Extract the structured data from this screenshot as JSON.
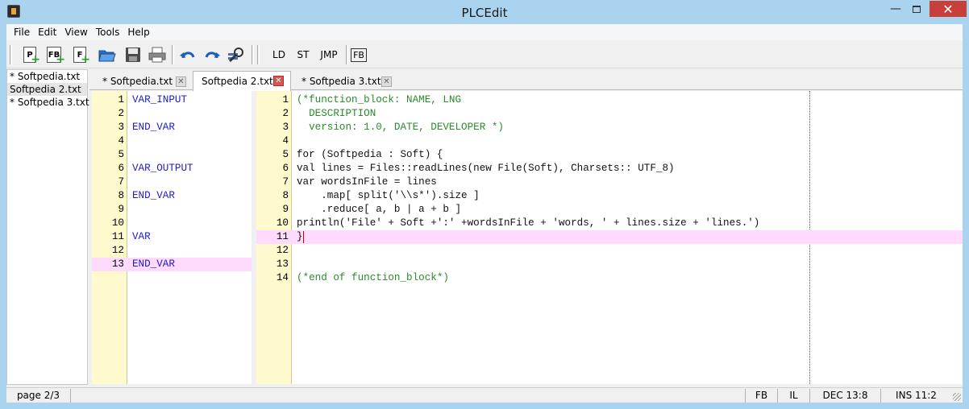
{
  "window": {
    "title": "PLCEdit"
  },
  "menu": [
    "File",
    "Edit",
    "View",
    "Tools",
    "Help"
  ],
  "toolbar": {
    "new_buttons": [
      "P",
      "FB",
      "F"
    ],
    "lang_buttons": [
      "LD",
      "ST",
      "JMP"
    ],
    "fb_button": "FB"
  },
  "files": [
    "* Softpedia.txt",
    "Softpedia 2.txt",
    "* Softpedia 3.txt"
  ],
  "tabs": [
    {
      "label": "* Softpedia.txt",
      "active": false
    },
    {
      "label": "Softpedia 2.txt",
      "active": true
    },
    {
      "label": "* Softpedia 3.txt",
      "active": false
    }
  ],
  "left_editor": {
    "current_line": 13,
    "lines": [
      {
        "n": "1",
        "text": "VAR_INPUT"
      },
      {
        "n": "2",
        "text": ""
      },
      {
        "n": "3",
        "text": "END_VAR"
      },
      {
        "n": "4",
        "text": ""
      },
      {
        "n": "5",
        "text": ""
      },
      {
        "n": "6",
        "text": "VAR_OUTPUT"
      },
      {
        "n": "7",
        "text": ""
      },
      {
        "n": "8",
        "text": "END_VAR"
      },
      {
        "n": "9",
        "text": ""
      },
      {
        "n": "10",
        "text": ""
      },
      {
        "n": "11",
        "text": "VAR"
      },
      {
        "n": "12",
        "text": ""
      },
      {
        "n": "13",
        "text": "END_VAR"
      }
    ]
  },
  "right_editor": {
    "current_line": 11,
    "lines": [
      {
        "n": "1",
        "text": "(*function_block: NAME, LNG",
        "style": "comment"
      },
      {
        "n": "2",
        "text": "  DESCRIPTION",
        "style": "comment"
      },
      {
        "n": "3",
        "text": "  version: 1.0, DATE, DEVELOPER *)",
        "style": "comment"
      },
      {
        "n": "4",
        "text": "",
        "style": "plain"
      },
      {
        "n": "5",
        "text": "for (Softpedia : Soft) {",
        "style": "plain"
      },
      {
        "n": "6",
        "text": "val lines = Files::readLines(new File(Soft), Charsets:: UTF_8)",
        "style": "plain"
      },
      {
        "n": "7",
        "text": "var wordsInFile = lines",
        "style": "plain"
      },
      {
        "n": "8",
        "text": "    .map[ split('\\\\s*').size ]",
        "style": "plain"
      },
      {
        "n": "9",
        "text": "    .reduce[ a, b | a + b ]",
        "style": "plain"
      },
      {
        "n": "10",
        "text": "println('File' + Soft +':' +wordsInFile + 'words, ' + lines.size + 'lines.')",
        "style": "plain"
      },
      {
        "n": "11",
        "text": "}",
        "style": "plain"
      },
      {
        "n": "12",
        "text": "",
        "style": "plain"
      },
      {
        "n": "13",
        "text": "",
        "style": "plain"
      },
      {
        "n": "14",
        "text": "(*end of function_block*)",
        "style": "comment"
      }
    ]
  },
  "status": {
    "page": "page 2/3",
    "block": "FB",
    "lang": "IL",
    "position": "DEC 13:8",
    "mode": "INS 11:2"
  },
  "colors": {
    "gutter": "#fffacd",
    "current_line": "#ffdaff",
    "keyword": "#2020c0",
    "comment": "#2b8a2b",
    "close_button": "#c7403a"
  }
}
